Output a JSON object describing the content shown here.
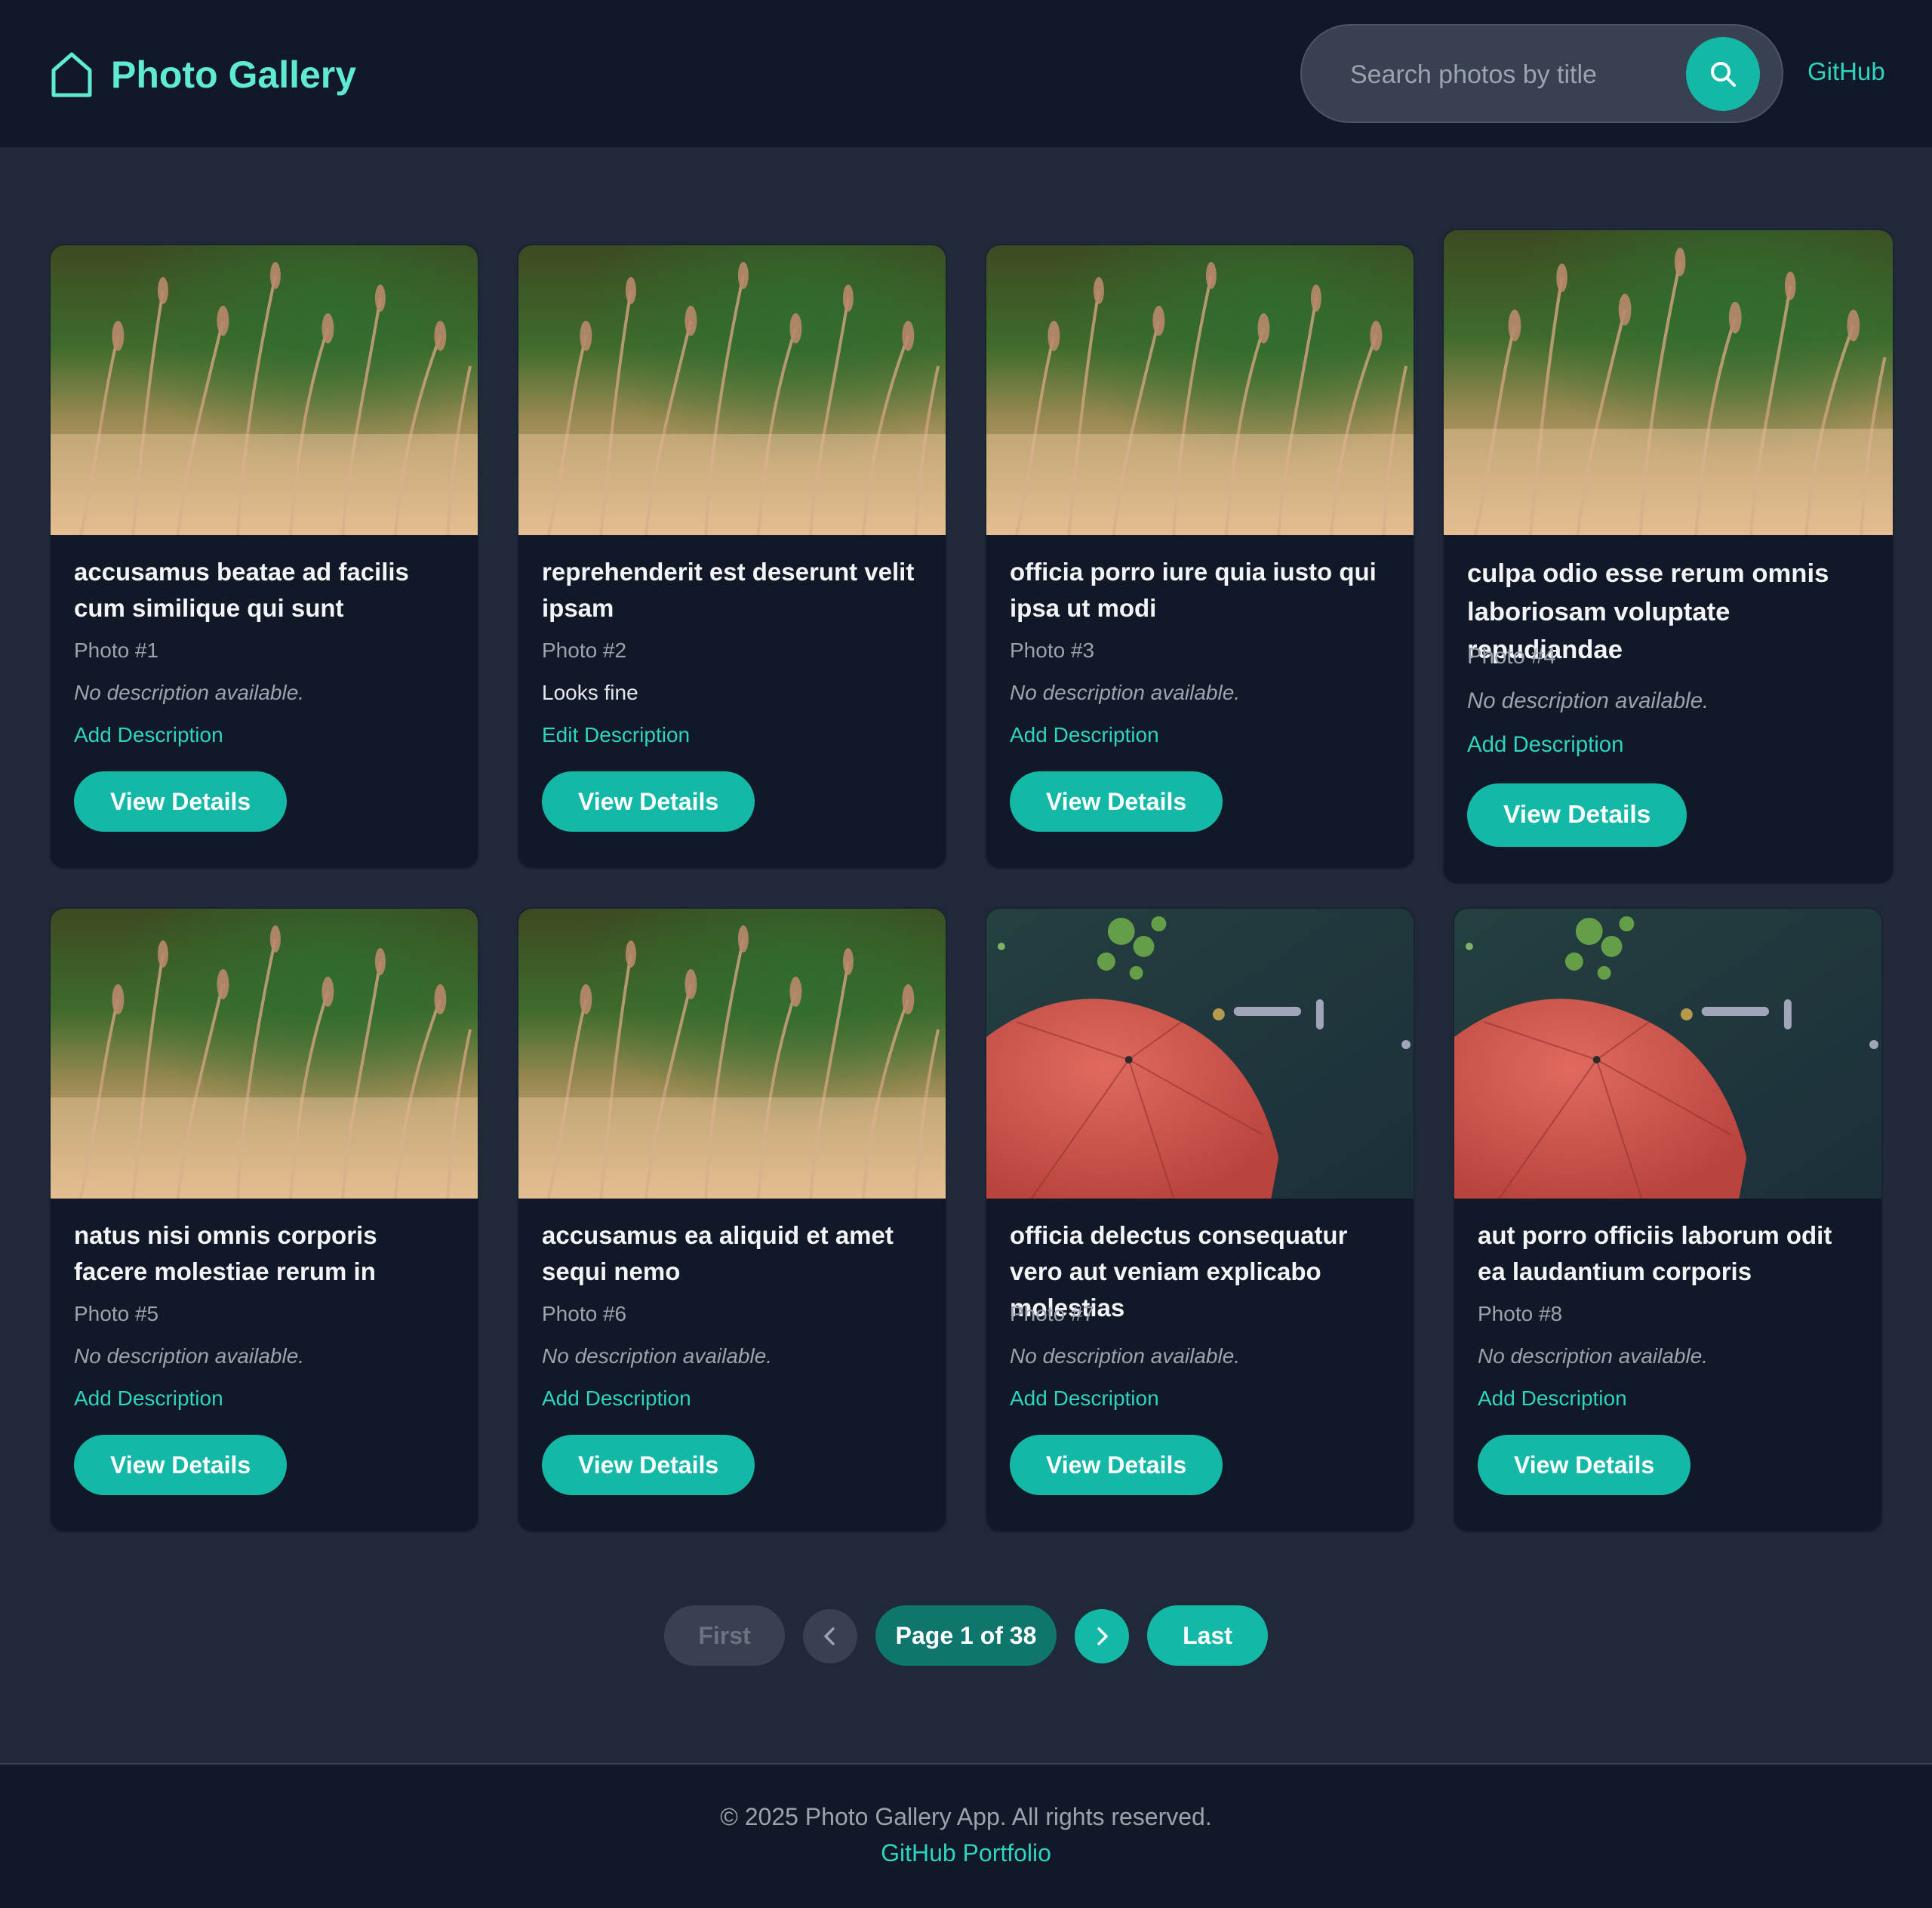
{
  "header": {
    "brand": "Photo Gallery",
    "search_placeholder": "Search photos by title",
    "github_label": "GitHub"
  },
  "photos": [
    {
      "title": "accusamus beatae ad facilis cum similique qui sunt",
      "number": "Photo #1",
      "description": "No description available.",
      "description_state": "empty",
      "action": "Add Description",
      "button": "View Details",
      "image": "grass"
    },
    {
      "title": "reprehenderit est deserunt velit ipsam",
      "number": "Photo #2",
      "description": "Looks fine",
      "description_state": "filled",
      "action": "Edit Description",
      "button": "View Details",
      "image": "grass"
    },
    {
      "title": "officia porro iure quia iusto qui ipsa ut modi",
      "number": "Photo #3",
      "description": "No description available.",
      "description_state": "empty",
      "action": "Add Description",
      "button": "View Details",
      "image": "grass"
    },
    {
      "title": "culpa odio esse rerum omnis laboriosam voluptate repudiandae",
      "number": "Photo #4",
      "description": "No description available.",
      "description_state": "empty",
      "action": "Add Description",
      "button": "View Details",
      "image": "grass"
    },
    {
      "title": "natus nisi omnis corporis facere molestiae rerum in",
      "number": "Photo #5",
      "description": "No description available.",
      "description_state": "empty",
      "action": "Add Description",
      "button": "View Details",
      "image": "grass"
    },
    {
      "title": "accusamus ea aliquid et amet sequi nemo",
      "number": "Photo #6",
      "description": "No description available.",
      "description_state": "empty",
      "action": "Add Description",
      "button": "View Details",
      "image": "grass"
    },
    {
      "title": "officia delectus consequatur vero aut veniam explicabo molestias",
      "number": "Photo #7",
      "description": "No description available.",
      "description_state": "empty",
      "action": "Add Description",
      "button": "View Details",
      "image": "umbrella"
    },
    {
      "title": "aut porro officiis laborum odit ea laudantium corporis",
      "number": "Photo #8",
      "description": "No description available.",
      "description_state": "empty",
      "action": "Add Description",
      "button": "View Details",
      "image": "umbrella"
    }
  ],
  "pagination": {
    "first": "First",
    "current": "Page 1 of 38",
    "last": "Last"
  },
  "footer": {
    "copyright": "© 2025 Photo Gallery App. All rights reserved.",
    "link": "GitHub Portfolio"
  },
  "colors": {
    "accent": "#14b8a6",
    "accent_text": "#2dd4bf",
    "brand": "#5eead4",
    "surface": "#111827",
    "background": "#1f2937"
  }
}
